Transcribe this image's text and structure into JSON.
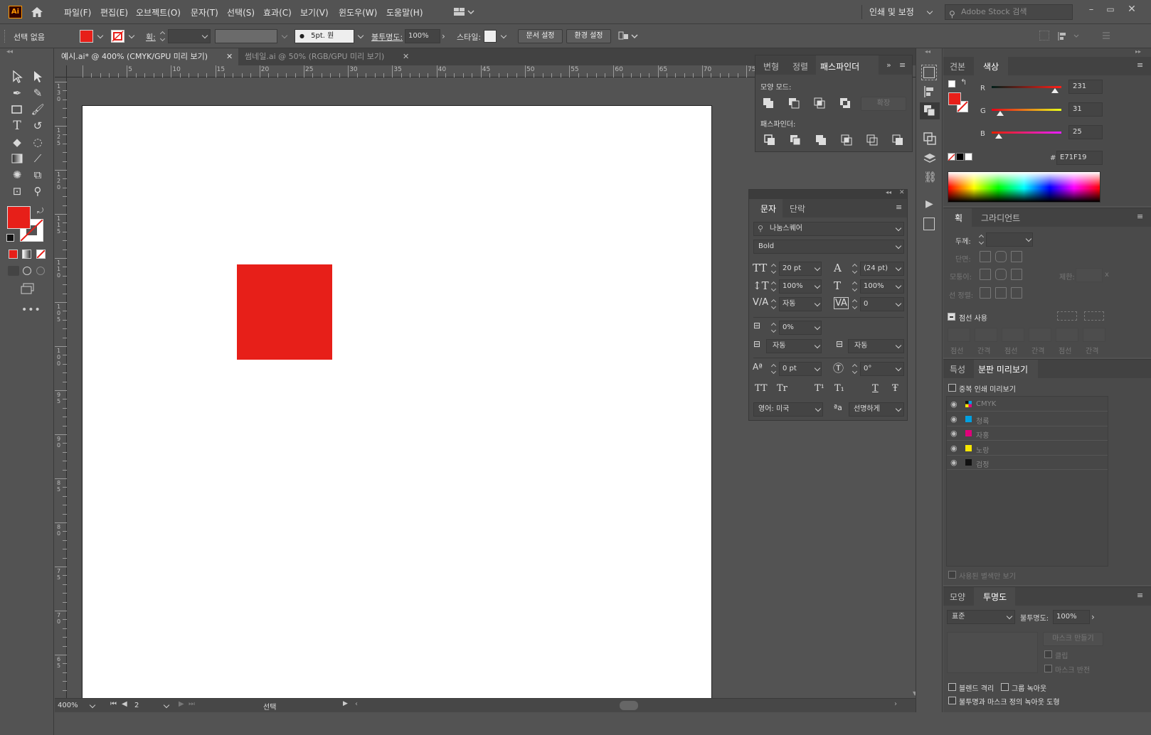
{
  "app": {
    "logo": "Ai"
  },
  "menu": [
    "파일(F)",
    "편집(E)",
    "오브젝트(O)",
    "문자(T)",
    "선택(S)",
    "효과(C)",
    "보기(V)",
    "윈도우(W)",
    "도움말(H)"
  ],
  "workspace": {
    "label": "인쇄 및 보정"
  },
  "search": {
    "placeholder": "Adobe Stock 검색"
  },
  "control": {
    "selection": "선택 없음",
    "stroke_label": "획:",
    "brush": "5pt. 원",
    "opacity_label": "불투명도:",
    "opacity": "100%",
    "style_label": "스타일:",
    "doc_setup": "문서 설정",
    "prefs": "환경 설정"
  },
  "colors": {
    "fill": "#E71F19",
    "canvas_bg": "#535353",
    "panel": "#4a4a4a"
  },
  "tabs": [
    {
      "label": "예시.ai* @ 400% (CMYK/GPU 미리 보기)",
      "active": true
    },
    {
      "label": "썸네일.ai @ 50% (RGB/GPU 미리 보기)",
      "active": false
    }
  ],
  "ruler": {
    "h": [
      "5",
      "10",
      "15",
      "20",
      "25",
      "30",
      "35",
      "40",
      "45",
      "50",
      "55",
      "60",
      "65",
      "70",
      "75"
    ],
    "v": [
      "1\n3\n0",
      "1\n2\n5",
      "1\n2\n0",
      "1\n1\n5",
      "1\n1\n0",
      "1\n0\n5",
      "1\n0\n0",
      "9\n5",
      "9\n0",
      "8\n5",
      "8\n0",
      "7\n5",
      "7\n0",
      "6\n5"
    ]
  },
  "pathfinder": {
    "tabs": [
      "변형",
      "정렬",
      "패스파인더"
    ],
    "shape_modes": "모양 모드:",
    "expand": "확장",
    "pathfinders": "패스파인더:"
  },
  "character": {
    "tabs": [
      "문자",
      "단락"
    ],
    "font": "나눔스퀘어",
    "style": "Bold",
    "size": "20 pt",
    "leading": "(24 pt)",
    "vscale": "100%",
    "hscale": "100%",
    "kerning": "자동",
    "tracking": "0",
    "tsume": "0%",
    "aki_left": "자동",
    "aki_right": "자동",
    "baseline": "0 pt",
    "rotation": "0°",
    "typo": [
      "TT",
      "Tr",
      "T¹",
      "T₁",
      "T",
      "Ŧ"
    ],
    "language": "영어: 미국",
    "aa_icon": "ªa",
    "antialias": "선명하게"
  },
  "color_panel": {
    "tabs": [
      "견본",
      "색상"
    ],
    "r_label": "R",
    "g_label": "G",
    "b_label": "B",
    "r": "231",
    "g": "31",
    "b": "25",
    "r_frac": 0.905,
    "g_frac": 0.12,
    "b_frac": 0.1,
    "hash": "#",
    "hex": "E71F19"
  },
  "stroke_panel": {
    "tabs": [
      "획",
      "그라디언트"
    ],
    "weight": "두께:",
    "cap": "단면:",
    "corner": "모퉁이:",
    "limit": "제한:",
    "align": "선 정렬:",
    "dashed": "점선 사용",
    "dash_labels": [
      "점선",
      "간격",
      "점선",
      "간격",
      "점선",
      "간격"
    ]
  },
  "separations": {
    "tabs": [
      "특성",
      "분판 미리보기"
    ],
    "overprint": "중복 인쇄 미리보기",
    "plates": [
      {
        "name": "CMYK",
        "color": "cmyk"
      },
      {
        "name": "청록",
        "color": "#00a0e0"
      },
      {
        "name": "자홍",
        "color": "#e0007a"
      },
      {
        "name": "노랑",
        "color": "#f7e600"
      },
      {
        "name": "검정",
        "color": "#111111"
      }
    ],
    "used_only": "사용된 별색만 보기"
  },
  "transparency": {
    "tabs": [
      "모양",
      "투명도"
    ],
    "mode": "표준",
    "opacity_label": "불투명도:",
    "opacity": "100%",
    "make_mask": "마스크 만들기",
    "clip": "클립",
    "invert": "마스크 반전",
    "isolate": "블렌드 격리",
    "knockout": "그룹 녹아웃",
    "shape": "불투명과 마스크 정의 녹아웃 도형"
  },
  "status": {
    "zoom": "400%",
    "artboard": "2",
    "tool": "선택"
  }
}
